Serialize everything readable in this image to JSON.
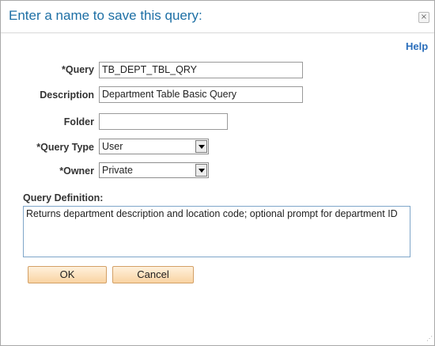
{
  "dialog": {
    "title": "Enter a name to save this query:",
    "close_icon": "close-icon",
    "close_glyph": "×",
    "help_label": "Help"
  },
  "form": {
    "query_name": {
      "label": "*Query",
      "value": "TB_DEPT_TBL_QRY"
    },
    "description": {
      "label": "Description",
      "value": "Department Table Basic Query"
    },
    "folder": {
      "label": "Folder",
      "value": ""
    },
    "query_type": {
      "label": "*Query Type",
      "value": "User"
    },
    "owner": {
      "label": "*Owner",
      "value": "Private"
    }
  },
  "definition": {
    "label": "Query Definition:",
    "value": "Returns department description and location code; optional prompt for department ID"
  },
  "buttons": {
    "ok": "OK",
    "cancel": "Cancel"
  },
  "colors": {
    "title": "#1d6fa5",
    "help_link": "#2a6ebb",
    "button_fill": "#f9d3a2",
    "button_border": "#d3a066",
    "textarea_border": "#7fa6c9"
  },
  "resize_grip_glyph": "⋰"
}
